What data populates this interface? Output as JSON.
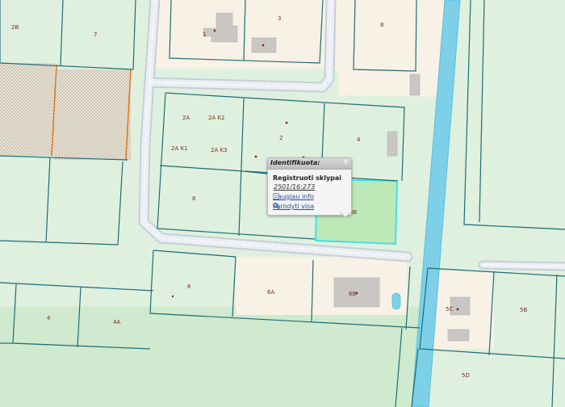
{
  "map": {
    "colors": {
      "background": "#dff0df",
      "built_area": "#f8f1e6",
      "parcel_line": "#1f6b74",
      "road_fill": "#ebeff3",
      "road_edge": "#c5cfd8",
      "river": "#7dd0e8",
      "highlight_fill": "#bce9b6",
      "highlight_stroke": "#40e0ee",
      "building": "#c9c7c3",
      "label": "#7a2a22",
      "fence": "#e0761a"
    },
    "parcel_labels": {
      "p2b": "2B",
      "p7": "7",
      "p1": "1",
      "p3": "3",
      "p8top": "8",
      "p2a": "2A",
      "p2ak2": "2A K2",
      "p2ak1": "2A K1",
      "p2ak3": "2A K3",
      "p2": "2",
      "p4top": "4",
      "p8": "8",
      "p8b": "8B",
      "p6": "6",
      "p6a": "6A",
      "p6b": "6B",
      "p5c": "5C",
      "p5b": "5B",
      "p4": "4",
      "p4a": "4A",
      "p5d": "5D"
    }
  },
  "popup": {
    "header": "Identifikuota:",
    "close_label": "×",
    "title": "Registruoti sklypai",
    "parcel_id": "2501/16:273",
    "more_info": "Daugiau info",
    "show_all": "Parodyti visa"
  }
}
